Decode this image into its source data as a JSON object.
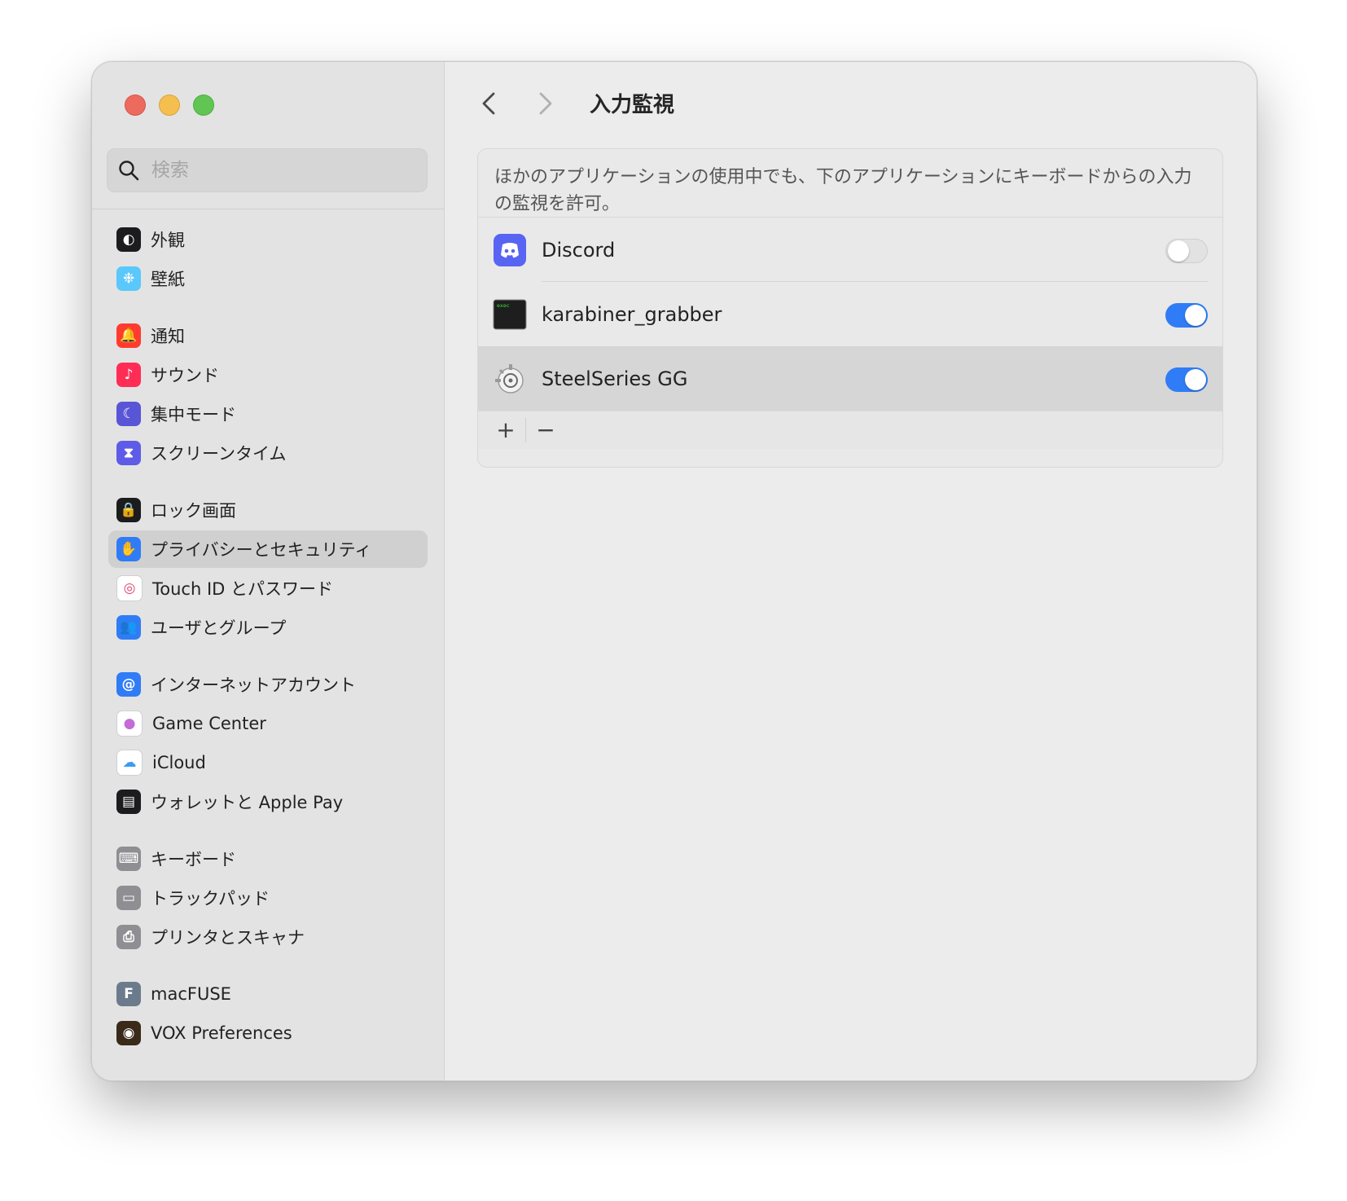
{
  "window": {
    "title": "入力監視"
  },
  "search": {
    "placeholder": "検索"
  },
  "sidebar": {
    "groups": [
      [
        {
          "label": "外観",
          "icon": "appearance-icon",
          "color": "#1c1c1e"
        },
        {
          "label": "壁紙",
          "icon": "wallpaper-icon",
          "color": "#5ac8fa"
        }
      ],
      [
        {
          "label": "通知",
          "icon": "bell-icon",
          "color": "#ff3b30"
        },
        {
          "label": "サウンド",
          "icon": "speaker-icon",
          "color": "#ff2d55"
        },
        {
          "label": "集中モード",
          "icon": "moon-icon",
          "color": "#5856d6"
        },
        {
          "label": "スクリーンタイム",
          "icon": "hourglass-icon",
          "color": "#5e5ce6"
        }
      ],
      [
        {
          "label": "ロック画面",
          "icon": "lock-icon",
          "color": "#1c1c1e"
        },
        {
          "label": "プライバシーとセキュリティ",
          "icon": "hand-icon",
          "color": "#2f7cf6",
          "active": true
        },
        {
          "label": "Touch ID とパスワード",
          "icon": "fingerprint-icon",
          "color": "#ffffff"
        },
        {
          "label": "ユーザとグループ",
          "icon": "users-icon",
          "color": "#2f7cf6"
        }
      ],
      [
        {
          "label": "インターネットアカウント",
          "icon": "at-icon",
          "color": "#2f7cf6"
        },
        {
          "label": "Game Center",
          "icon": "game-center-icon",
          "color": "#ffffff"
        },
        {
          "label": "iCloud",
          "icon": "cloud-icon",
          "color": "#ffffff"
        },
        {
          "label": "ウォレットと Apple Pay",
          "icon": "wallet-icon",
          "color": "#1c1c1e"
        }
      ],
      [
        {
          "label": "キーボード",
          "icon": "keyboard-icon",
          "color": "#8e8e93"
        },
        {
          "label": "トラックパッド",
          "icon": "trackpad-icon",
          "color": "#8e8e93"
        },
        {
          "label": "プリンタとスキャナ",
          "icon": "printer-icon",
          "color": "#8e8e93"
        }
      ],
      [
        {
          "label": "macFUSE",
          "icon": "macfuse-icon",
          "color": "#6b7b8c"
        },
        {
          "label": "VOX Preferences",
          "icon": "vox-icon",
          "color": "#3a2a1a"
        }
      ]
    ]
  },
  "main": {
    "description": "ほかのアプリケーションの使用中でも、下のアプリケーションにキーボードからの入力の監視を許可。",
    "apps": [
      {
        "name": "Discord",
        "icon": "discord-icon",
        "enabled": false,
        "selected": false
      },
      {
        "name": "karabiner_grabber",
        "icon": "exec-terminal-icon",
        "enabled": true,
        "selected": false
      },
      {
        "name": "SteelSeries GG",
        "icon": "steelseries-icon",
        "enabled": true,
        "selected": true
      }
    ],
    "add_label": "+",
    "remove_label": "−"
  },
  "colors": {
    "accent": "#2f7cf6",
    "exec_text": "#3adf3a"
  }
}
